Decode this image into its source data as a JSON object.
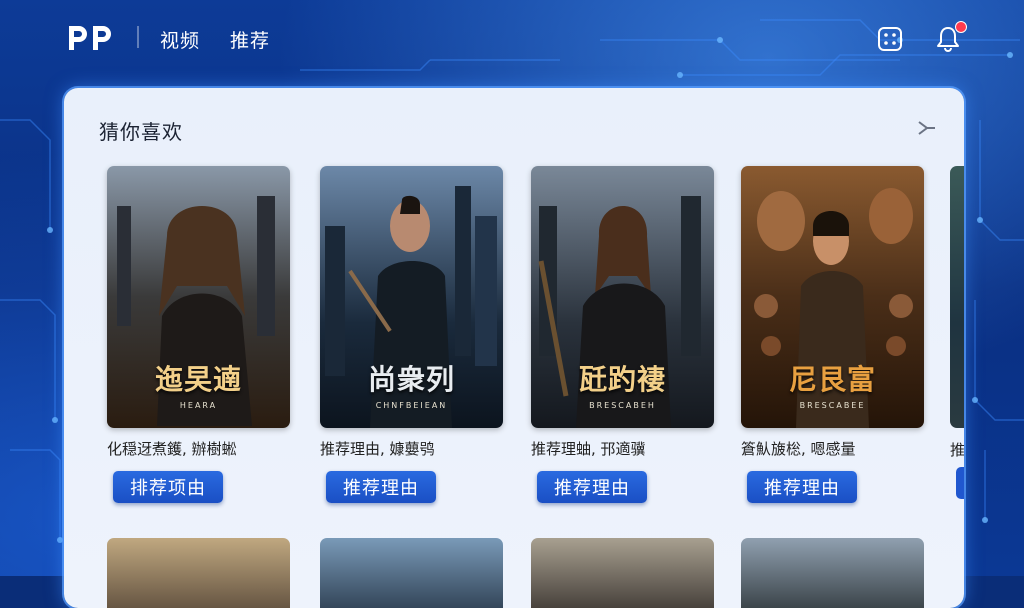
{
  "header": {
    "logo": "PP",
    "nav": [
      "视频",
      "推荐"
    ],
    "icons": [
      "dice-icon",
      "bell-icon"
    ]
  },
  "section": {
    "title": "猜你喜欢",
    "more_icon": "chevron-right-icon"
  },
  "cards": [
    {
      "poster_title": "迤旲遖",
      "poster_sub": "HEARA",
      "reason": "化穏迓煮鑊, 辦樹蜙",
      "button": "排荐项由",
      "palette": [
        "#1c2430",
        "#5a5040",
        "#b08a50"
      ]
    },
    {
      "poster_title": "尚衆列",
      "poster_sub": "CHNFBEIEAN",
      "reason": "推荐理由, 嫝蘡鸮",
      "button": "推荐理由",
      "palette": [
        "#0e1e30",
        "#304a66",
        "#8aa0b8"
      ]
    },
    {
      "poster_title": "瓩趵褄",
      "poster_sub": "BRESCABEH",
      "reason": "推荐理蚰, 邘適骥",
      "button": "推荐理由",
      "palette": [
        "#141c26",
        "#34404c",
        "#a08050"
      ]
    },
    {
      "poster_title": "尼艮富",
      "poster_sub": "BRESCABEE",
      "reason": "篬魜旇棇, 嗯感量",
      "button": "推荐理由",
      "palette": [
        "#2a1a10",
        "#6a4424",
        "#c08040"
      ]
    }
  ],
  "peek_card": {
    "reason_char": "推"
  },
  "colors": {
    "accent": "#1f57cc",
    "background": "#0b3894",
    "panel": "#eaf1fb",
    "badge": "#ff3b4f"
  }
}
